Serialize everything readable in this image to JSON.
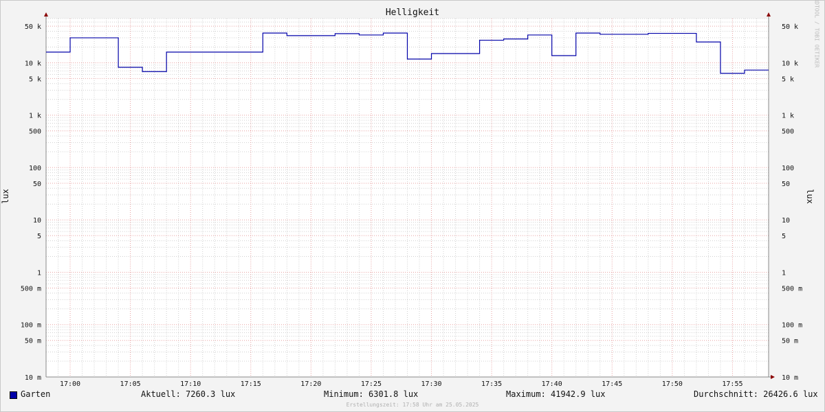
{
  "chart_data": {
    "type": "line",
    "title": "Helligkeit",
    "ylabel": "lux",
    "yscale": "log",
    "ylim": [
      0.01,
      70000
    ],
    "xlim": [
      "16:58",
      "17:58"
    ],
    "x_ticks": [
      "17:00",
      "17:05",
      "17:10",
      "17:15",
      "17:20",
      "17:25",
      "17:30",
      "17:35",
      "17:40",
      "17:45",
      "17:50",
      "17:55"
    ],
    "y_ticks": [
      {
        "value": 50000,
        "label": "50 k"
      },
      {
        "value": 10000,
        "label": "10 k"
      },
      {
        "value": 5000,
        "label": "5 k"
      },
      {
        "value": 1000,
        "label": "1 k"
      },
      {
        "value": 500,
        "label": "500"
      },
      {
        "value": 100,
        "label": "100"
      },
      {
        "value": 50,
        "label": "50"
      },
      {
        "value": 10,
        "label": "10"
      },
      {
        "value": 5,
        "label": "5"
      },
      {
        "value": 1,
        "label": "1"
      },
      {
        "value": 0.5,
        "label": "500 m"
      },
      {
        "value": 0.1,
        "label": "100 m"
      },
      {
        "value": 0.05,
        "label": "50 m"
      },
      {
        "value": 0.01,
        "label": "10 m"
      }
    ],
    "grid": true,
    "series": [
      {
        "name": "Garten",
        "color": "#0000a8",
        "step": true,
        "points": [
          {
            "x": "16:58",
            "y": 16000
          },
          {
            "x": "17:00",
            "y": 30000
          },
          {
            "x": "17:04",
            "y": 8200
          },
          {
            "x": "17:06",
            "y": 6800
          },
          {
            "x": "17:08",
            "y": 16000
          },
          {
            "x": "17:16",
            "y": 37000
          },
          {
            "x": "17:18",
            "y": 33000
          },
          {
            "x": "17:22",
            "y": 36000
          },
          {
            "x": "17:24",
            "y": 34000
          },
          {
            "x": "17:26",
            "y": 37000
          },
          {
            "x": "17:28",
            "y": 11800
          },
          {
            "x": "17:30",
            "y": 15000
          },
          {
            "x": "17:34",
            "y": 27000
          },
          {
            "x": "17:36",
            "y": 28500
          },
          {
            "x": "17:38",
            "y": 34000
          },
          {
            "x": "17:40",
            "y": 13700
          },
          {
            "x": "17:42",
            "y": 37000
          },
          {
            "x": "17:44",
            "y": 35000
          },
          {
            "x": "17:48",
            "y": 36500
          },
          {
            "x": "17:52",
            "y": 25000
          },
          {
            "x": "17:54",
            "y": 6300
          },
          {
            "x": "17:56",
            "y": 7260
          },
          {
            "x": "17:58",
            "y": 7260
          }
        ]
      }
    ]
  },
  "legend": {
    "series_name": "Garten",
    "current": "Aktuell: 7260.3 lux",
    "minimum": "Minimum: 6301.8 lux",
    "maximum": "Maximum: 41942.9 lux",
    "average": "Durchschnitt: 26426.6 lux"
  },
  "watermark": "RRDTOOL / TOBI OETIKER",
  "footer": "Erstellungszeit: 17:58 Uhr am 25.05.2025",
  "colors": {
    "background": "#f3f3f3",
    "plot_background": "#ffffff",
    "major_grid": "#e8a0a0",
    "minor_grid": "#d0d0d0",
    "series": "#0000a8",
    "axis_arrow": "#8b0000"
  }
}
